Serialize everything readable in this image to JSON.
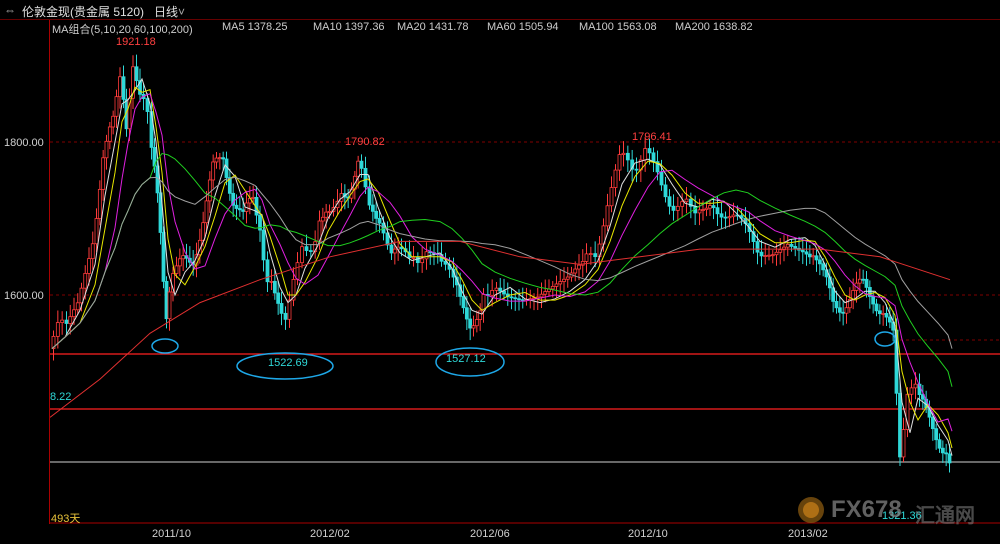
{
  "toolbar": {
    "title": "伦敦金现(贵金属 5120)",
    "period": "日线",
    "period_chevron": "chevron-down-icon"
  },
  "ma_indicators": [
    {
      "label": "MA组合(5,10,20,60,100,200)",
      "color": "#e8c23a"
    },
    {
      "label": "MA5 1378.25",
      "color": "#e0e0e0"
    },
    {
      "label": "MA10 1397.36",
      "color": "#e8e800"
    },
    {
      "label": "MA20 1431.78",
      "color": "#e020e0"
    },
    {
      "label": "MA60 1505.94",
      "color": "#20d020"
    },
    {
      "label": "MA100 1563.08",
      "color": "#a0a0a0"
    },
    {
      "label": "MA200 1638.82",
      "color": "#e03030"
    }
  ],
  "y_axis": {
    "ticks": [
      "1800.00",
      "1600.00"
    ]
  },
  "x_axis": {
    "ticks": [
      "2011/10",
      "2012/02",
      "2012/06",
      "2012/10",
      "2013/02"
    ]
  },
  "annotations": {
    "peak1": "1921.18",
    "peak2": "1790.82",
    "peak3": "1796.41",
    "low1": "1522.69",
    "low2": "1527.12",
    "low3": "1321.36",
    "left_value": "8.22",
    "days": "493天"
  },
  "watermark": {
    "text": "FX678",
    "subtext": "汇通网"
  },
  "colors": {
    "bull": "#ff3b3b",
    "bear": "#2fd8d8",
    "grid": "#800000",
    "support": "#ff2020",
    "ellipse": "#1ea8e8"
  },
  "chart_data": {
    "type": "line",
    "instrument": "伦敦金现",
    "y_range": [
      1300,
      1980
    ],
    "x_ticks": [
      "2011/10",
      "2012/02",
      "2012/06",
      "2012/10",
      "2013/02"
    ],
    "price_markers": {
      "high": 1921.18,
      "high2": 1790.82,
      "high3": 1796.41,
      "low1": 1522.69,
      "low2": 1527.12,
      "low3": 1321.36
    },
    "horizontal_levels": [
      1800,
      1600,
      1522,
      1450,
      1380
    ]
  }
}
